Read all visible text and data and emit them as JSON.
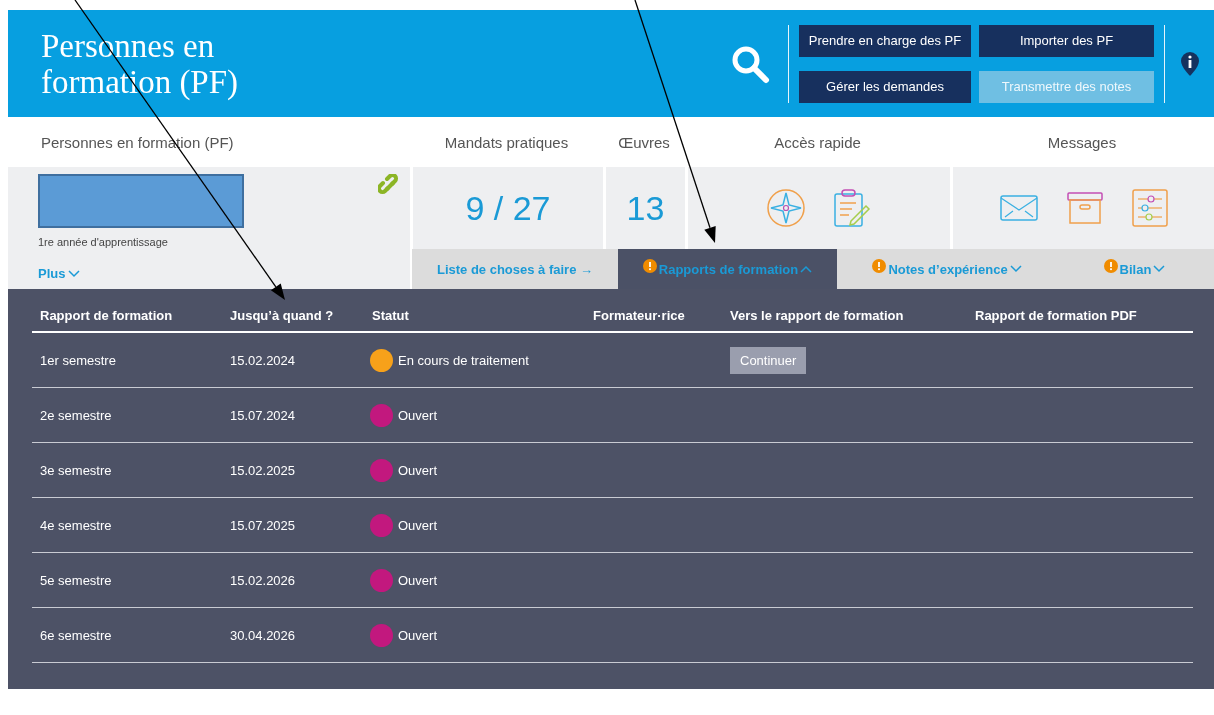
{
  "header": {
    "title": "Personnes en formation (PF)",
    "buttons": [
      {
        "label": "Prendre en charge des PF",
        "disabled": false
      },
      {
        "label": "Importer des PF",
        "disabled": false
      },
      {
        "label": "Gérer les demandes",
        "disabled": false
      },
      {
        "label": "Transmettre des notes",
        "disabled": true
      }
    ]
  },
  "summary": {
    "person": {
      "heading": "Personnes en formation (PF)",
      "subtitle": "1re année d'apprentissage",
      "more": "Plus"
    },
    "mandates": {
      "heading": "Mandats pratiques",
      "value": "9 / 27"
    },
    "works": {
      "heading": "Œuvres",
      "value": "13"
    },
    "quick_access": {
      "heading": "Accès rapide"
    },
    "messages": {
      "heading": "Messages"
    }
  },
  "tabs": [
    {
      "label": "Liste de choses à faire →",
      "kind": "link",
      "alert": false,
      "selected": false
    },
    {
      "label": "Rapports de formation",
      "kind": "dropdown",
      "alert": true,
      "selected": true
    },
    {
      "label": "Notes d’expérience",
      "kind": "dropdown",
      "alert": true,
      "selected": false
    },
    {
      "label": "Bilan",
      "kind": "dropdown",
      "alert": true,
      "selected": false
    }
  ],
  "table": {
    "columns": [
      "Rapport de formation",
      "Jusqu’à quand ?",
      "Statut",
      "Formateur·rice",
      "Vers le rapport de formation",
      "Rapport de formation PDF"
    ],
    "rows": [
      {
        "report": "1er semestre",
        "due": "15.02.2024",
        "status": "En cours de traitement",
        "color": "#f7a11a",
        "action": "Continuer"
      },
      {
        "report": "2e semestre",
        "due": "15.07.2024",
        "status": "Ouvert",
        "color": "#c2187e"
      },
      {
        "report": "3e semestre",
        "due": "15.02.2025",
        "status": "Ouvert",
        "color": "#c2187e"
      },
      {
        "report": "4e semestre",
        "due": "15.07.2025",
        "status": "Ouvert",
        "color": "#c2187e"
      },
      {
        "report": "5e semestre",
        "due": "15.02.2026",
        "status": "Ouvert",
        "color": "#c2187e"
      },
      {
        "report": "6e semestre",
        "due": "30.04.2026",
        "status": "Ouvert",
        "color": "#c2187e"
      }
    ]
  }
}
